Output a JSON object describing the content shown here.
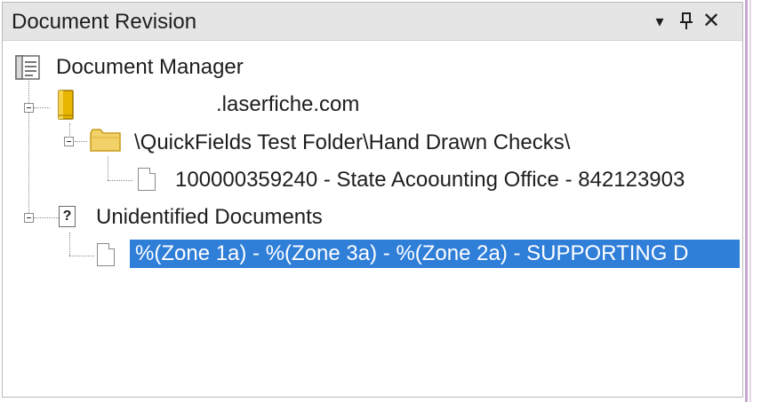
{
  "panel": {
    "title": "Document Revision",
    "buttons": {
      "dropdown": "▾",
      "pin": "⊥",
      "close": "✕"
    }
  },
  "tree": {
    "root": {
      "label": "Document Manager"
    },
    "server": {
      "label": ".laserfiche.com",
      "folder": {
        "label": "\\QuickFields Test Folder\\Hand Drawn Checks\\",
        "document": {
          "label": "100000359240 - State Acoounting Office - 842123903"
        }
      }
    },
    "unidentified": {
      "label": "Unidentified Documents",
      "document": {
        "label": "%(Zone 1a) - %(Zone 3a) - %(Zone 2a) - SUPPORTING D"
      }
    }
  },
  "colors": {
    "selection": "#2f7ed8",
    "titlebar": "#e5e5e5",
    "folder": "#f2d268",
    "repository": "#e8b500"
  }
}
